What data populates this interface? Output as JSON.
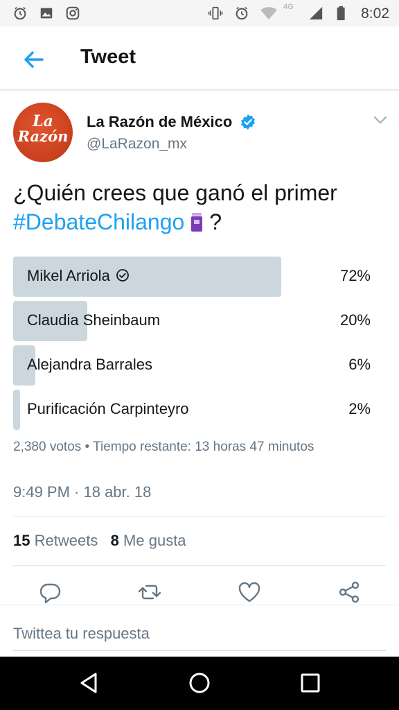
{
  "status_bar": {
    "time": "8:02",
    "network": "4G",
    "left_icons": [
      "alarm-icon",
      "image-icon",
      "instagram-icon"
    ],
    "right_icons": [
      "vibrate-icon",
      "alarm-icon",
      "wifi-icon",
      "signal-icon",
      "battery-icon"
    ]
  },
  "header": {
    "title": "Tweet",
    "back_icon": "arrow-left-icon",
    "accent": "#1da1f2"
  },
  "author": {
    "avatar_line1": "La",
    "avatar_line2": "Razón",
    "name": "La Razón de México",
    "handle": "@LaRazon_mx",
    "verified": true
  },
  "tweet": {
    "text_before": "¿Quién crees que ganó el primer",
    "hashtag": "#DebateChilango",
    "text_after": "?"
  },
  "poll": {
    "options": [
      {
        "label": "Mikel Arriola",
        "percent": "72%",
        "fraction": 0.745,
        "selected": true
      },
      {
        "label": "Claudia Sheinbaum",
        "percent": "20%",
        "fraction": 0.206,
        "selected": false
      },
      {
        "label": "Alejandra Barrales",
        "percent": "6%",
        "fraction": 0.062,
        "selected": false
      },
      {
        "label": "Purificación Carpinteyro",
        "percent": "2%",
        "fraction": 0.02,
        "selected": false
      }
    ],
    "meta": "2,380 votos • Tiempo restante: 13 horas 47 minutos",
    "bar_color": "#ccd6dd"
  },
  "timestamp": "9:49 PM · 18 abr. 18",
  "stats": {
    "retweets_count": "15",
    "retweets_label": "Retweets",
    "likes_count": "8",
    "likes_label": "Me gusta"
  },
  "actions": [
    "reply-icon",
    "retweet-icon",
    "like-icon",
    "share-icon"
  ],
  "reply": {
    "placeholder": "Twittea tu respuesta"
  },
  "nav": [
    "back-triangle-icon",
    "home-circle-icon",
    "recents-square-icon"
  ]
}
